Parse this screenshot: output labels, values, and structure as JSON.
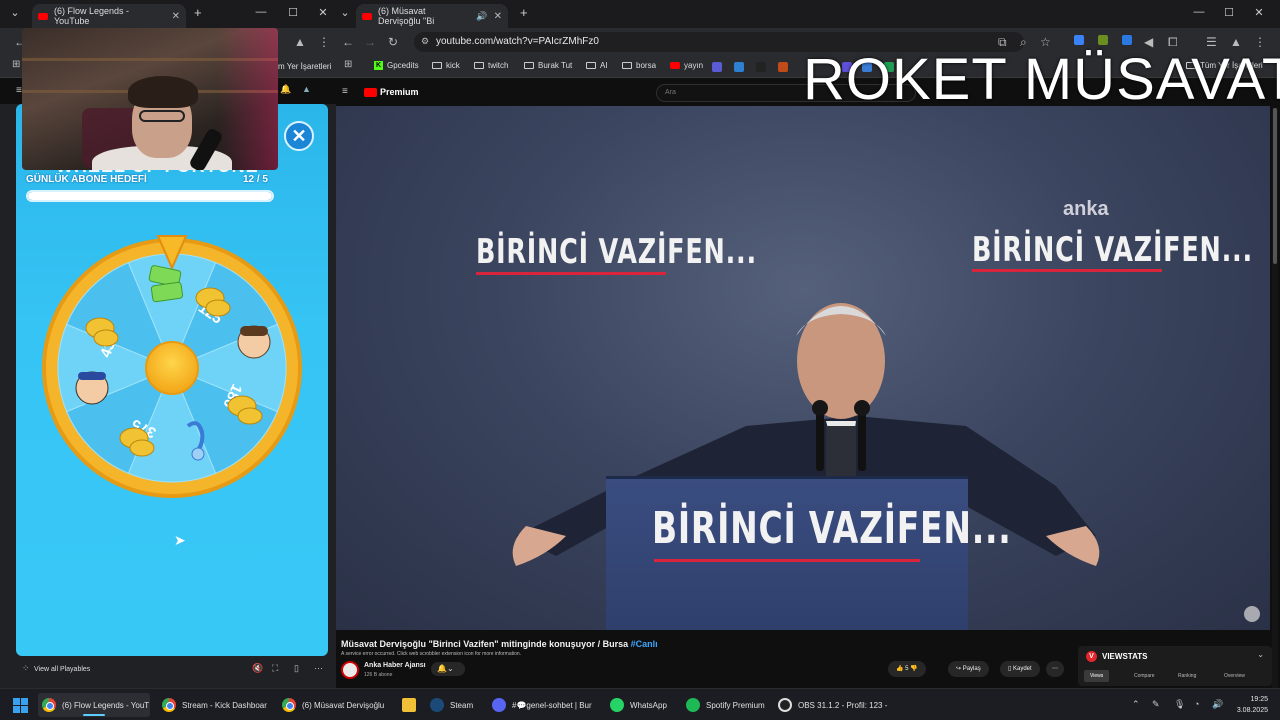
{
  "left_window": {
    "tab_title": "(6) Flow Legends - YouTube",
    "bookmark_partial": "m Yer İşaretleri",
    "game": {
      "title": "WHEEL OF FORTUNE",
      "goal_label": "GÜNLÜK ABONE HEDEFİ",
      "goal_current": "12",
      "goal_total": "5",
      "goal_count_text": "12 / 5",
      "goal_progress": 1.0,
      "wheel_values": [
        "125",
        "180",
        "375",
        "435"
      ],
      "close_icon": "close-icon"
    },
    "footer_label": "View all Playables"
  },
  "right_window": {
    "tab_title": "(6) Müsavat Dervişoğlu \"Bi",
    "url": "youtube.com/watch?v=PAIcrZMhFz0",
    "bookmarks": [
      "Gpcedits",
      "kick",
      "twitch",
      "Burak Tut",
      "AI",
      "borsa",
      "yayın"
    ],
    "bookmarks_right": "Tüm Yer İşaretleri",
    "youtube": {
      "logo": "Premium",
      "search_placeholder": "Ara"
    },
    "overlay_text": "ROKET MÜSAVAT",
    "video": {
      "banner_left": "BİRİNCİ VAZİFEN...",
      "banner_right": "BİRİNCİ VAZİFEN...",
      "brand": "anka",
      "podium_text": "BİRİNCİ VAZİFEN..."
    },
    "video_title": "Müsavat Dervişoğlu \"Birinci Vazifen\" mitinginde konuşuyor / Bursa",
    "video_tag": "#Canlı",
    "error_note": "A service error occurred. Click web scrobbler extension icon for more information.",
    "channel_name": "Anka Haber Ajansı",
    "channel_subs": "126 B abone",
    "actions": {
      "likes": "5",
      "share": "Paylaş",
      "save": "Kaydet"
    },
    "viewstats": {
      "title": "VIEWSTATS",
      "tabs": [
        "Views",
        "Compare",
        "Ranking",
        "Overview"
      ]
    }
  },
  "taskbar": {
    "items": [
      {
        "label": "(6) Flow Legends - YouT",
        "icon": "chrome-icon",
        "active": true
      },
      {
        "label": "Stream - Kick Dashboar",
        "icon": "chrome-icon",
        "active": false
      },
      {
        "label": "(6) Müsavat Dervişoğlu",
        "icon": "chrome-icon",
        "active": false
      },
      {
        "label": "",
        "icon": "folder-icon",
        "active": false
      },
      {
        "label": "Steam",
        "icon": "steam-icon",
        "active": false
      },
      {
        "label": "#💬genel-sohbet | Bur",
        "icon": "discord-icon",
        "active": false
      },
      {
        "label": "WhatsApp",
        "icon": "whatsapp-icon",
        "active": false
      },
      {
        "label": "Spotify Premium",
        "icon": "spotify-icon",
        "active": false
      },
      {
        "label": "OBS 31.1.2 - Profil: 123 -",
        "icon": "obs-icon",
        "active": false
      }
    ],
    "time": "19:25",
    "date": "3.08.2025"
  },
  "colors": {
    "game_bg": "#36c4f4",
    "wheel_rim": "#f5b52a",
    "youtube_red": "#ff0000",
    "taskbar_accent": "#60cdff"
  }
}
